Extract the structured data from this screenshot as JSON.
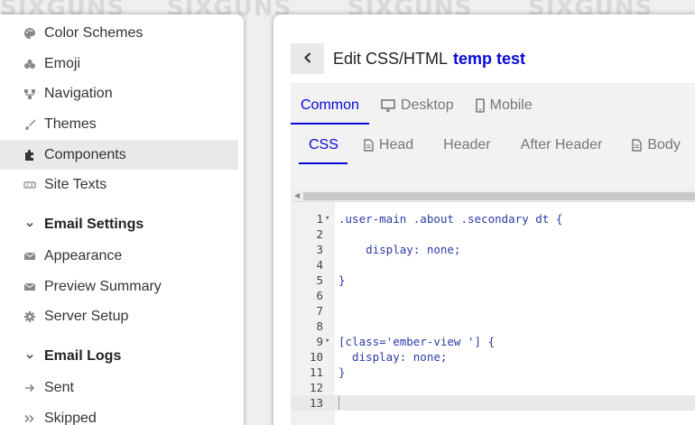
{
  "watermark": [
    "SIXGUNS",
    "SIXGUNS",
    "SIXGUNS",
    "SIXGUNS"
  ],
  "sidebar": {
    "items": [
      {
        "label": "Color Schemes",
        "icon": "palette-icon"
      },
      {
        "label": "Emoji",
        "icon": "emoji-icon"
      },
      {
        "label": "Navigation",
        "icon": "navigation-icon"
      },
      {
        "label": "Themes",
        "icon": "brush-icon"
      },
      {
        "label": "Components",
        "icon": "puzzle-icon",
        "active": true
      },
      {
        "label": "Site Texts",
        "icon": "text-icon"
      }
    ],
    "email_settings": {
      "heading": "Email Settings",
      "items": [
        {
          "label": "Appearance",
          "icon": "envelope-icon"
        },
        {
          "label": "Preview Summary",
          "icon": "envelope-icon"
        },
        {
          "label": "Server Setup",
          "icon": "gear-icon"
        }
      ]
    },
    "email_logs": {
      "heading": "Email Logs",
      "items": [
        {
          "label": "Sent",
          "icon": "arrow-right-icon"
        },
        {
          "label": "Skipped",
          "icon": "double-chevron-icon"
        }
      ]
    }
  },
  "header": {
    "title": "Edit CSS/HTML",
    "theme_name": "temp test"
  },
  "tabs": {
    "top": [
      {
        "label": "Common",
        "active": true
      },
      {
        "label": "Desktop",
        "icon": "desktop-icon"
      },
      {
        "label": "Mobile",
        "icon": "mobile-icon"
      }
    ],
    "sub": [
      {
        "label": "CSS",
        "active": true
      },
      {
        "label": "Head",
        "icon": "file-icon"
      },
      {
        "label": "Header"
      },
      {
        "label": "After Header"
      },
      {
        "label": "Body",
        "icon": "file-icon"
      }
    ]
  },
  "editor": {
    "lines": [
      {
        "n": "1",
        "fold": true,
        "code": ".user-main .about .secondary dt {"
      },
      {
        "n": "2",
        "code": ""
      },
      {
        "n": "3",
        "code": "    display: none;"
      },
      {
        "n": "4",
        "code": ""
      },
      {
        "n": "5",
        "code": "}"
      },
      {
        "n": "6",
        "code": ""
      },
      {
        "n": "7",
        "code": ""
      },
      {
        "n": "8",
        "code": ""
      },
      {
        "n": "9",
        "fold": true,
        "code": "[class='ember-view '] {"
      },
      {
        "n": "10",
        "code": "  display: none;"
      },
      {
        "n": "11",
        "code": "}"
      },
      {
        "n": "12",
        "code": ""
      },
      {
        "n": "13",
        "code": "",
        "current": true
      }
    ]
  },
  "colors": {
    "accent": "#0a0ad8",
    "code_token": "#2b3ba3"
  }
}
